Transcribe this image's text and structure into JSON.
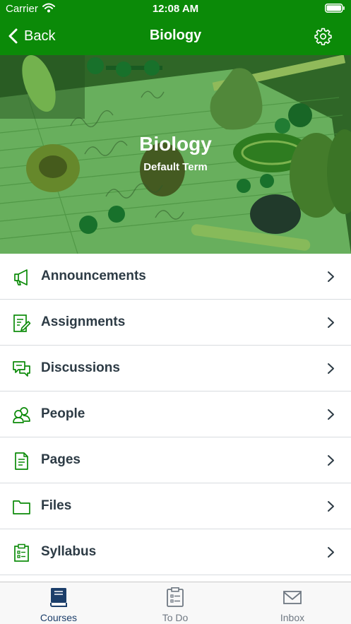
{
  "status_bar": {
    "carrier": "Carrier",
    "time": "12:08 AM"
  },
  "nav": {
    "back_label": "Back",
    "title": "Biology"
  },
  "course": {
    "name": "Biology",
    "term": "Default Term"
  },
  "menu": {
    "items": [
      {
        "label": "Announcements",
        "icon": "megaphone-icon"
      },
      {
        "label": "Assignments",
        "icon": "assignment-icon"
      },
      {
        "label": "Discussions",
        "icon": "discussion-icon"
      },
      {
        "label": "People",
        "icon": "people-icon"
      },
      {
        "label": "Pages",
        "icon": "page-icon"
      },
      {
        "label": "Files",
        "icon": "folder-icon"
      },
      {
        "label": "Syllabus",
        "icon": "syllabus-icon"
      }
    ]
  },
  "tabbar": {
    "tabs": [
      {
        "label": "Courses",
        "icon": "book-icon",
        "active": true
      },
      {
        "label": "To Do",
        "icon": "clipboard-icon",
        "active": false
      },
      {
        "label": "Inbox",
        "icon": "envelope-icon",
        "active": false
      }
    ]
  },
  "colors": {
    "brand_green": "#0b8a08",
    "icon_green": "#0b8a08",
    "text_dark": "#2d3b45",
    "tab_active": "#1c3e6a",
    "tab_inactive": "#6f7882"
  }
}
